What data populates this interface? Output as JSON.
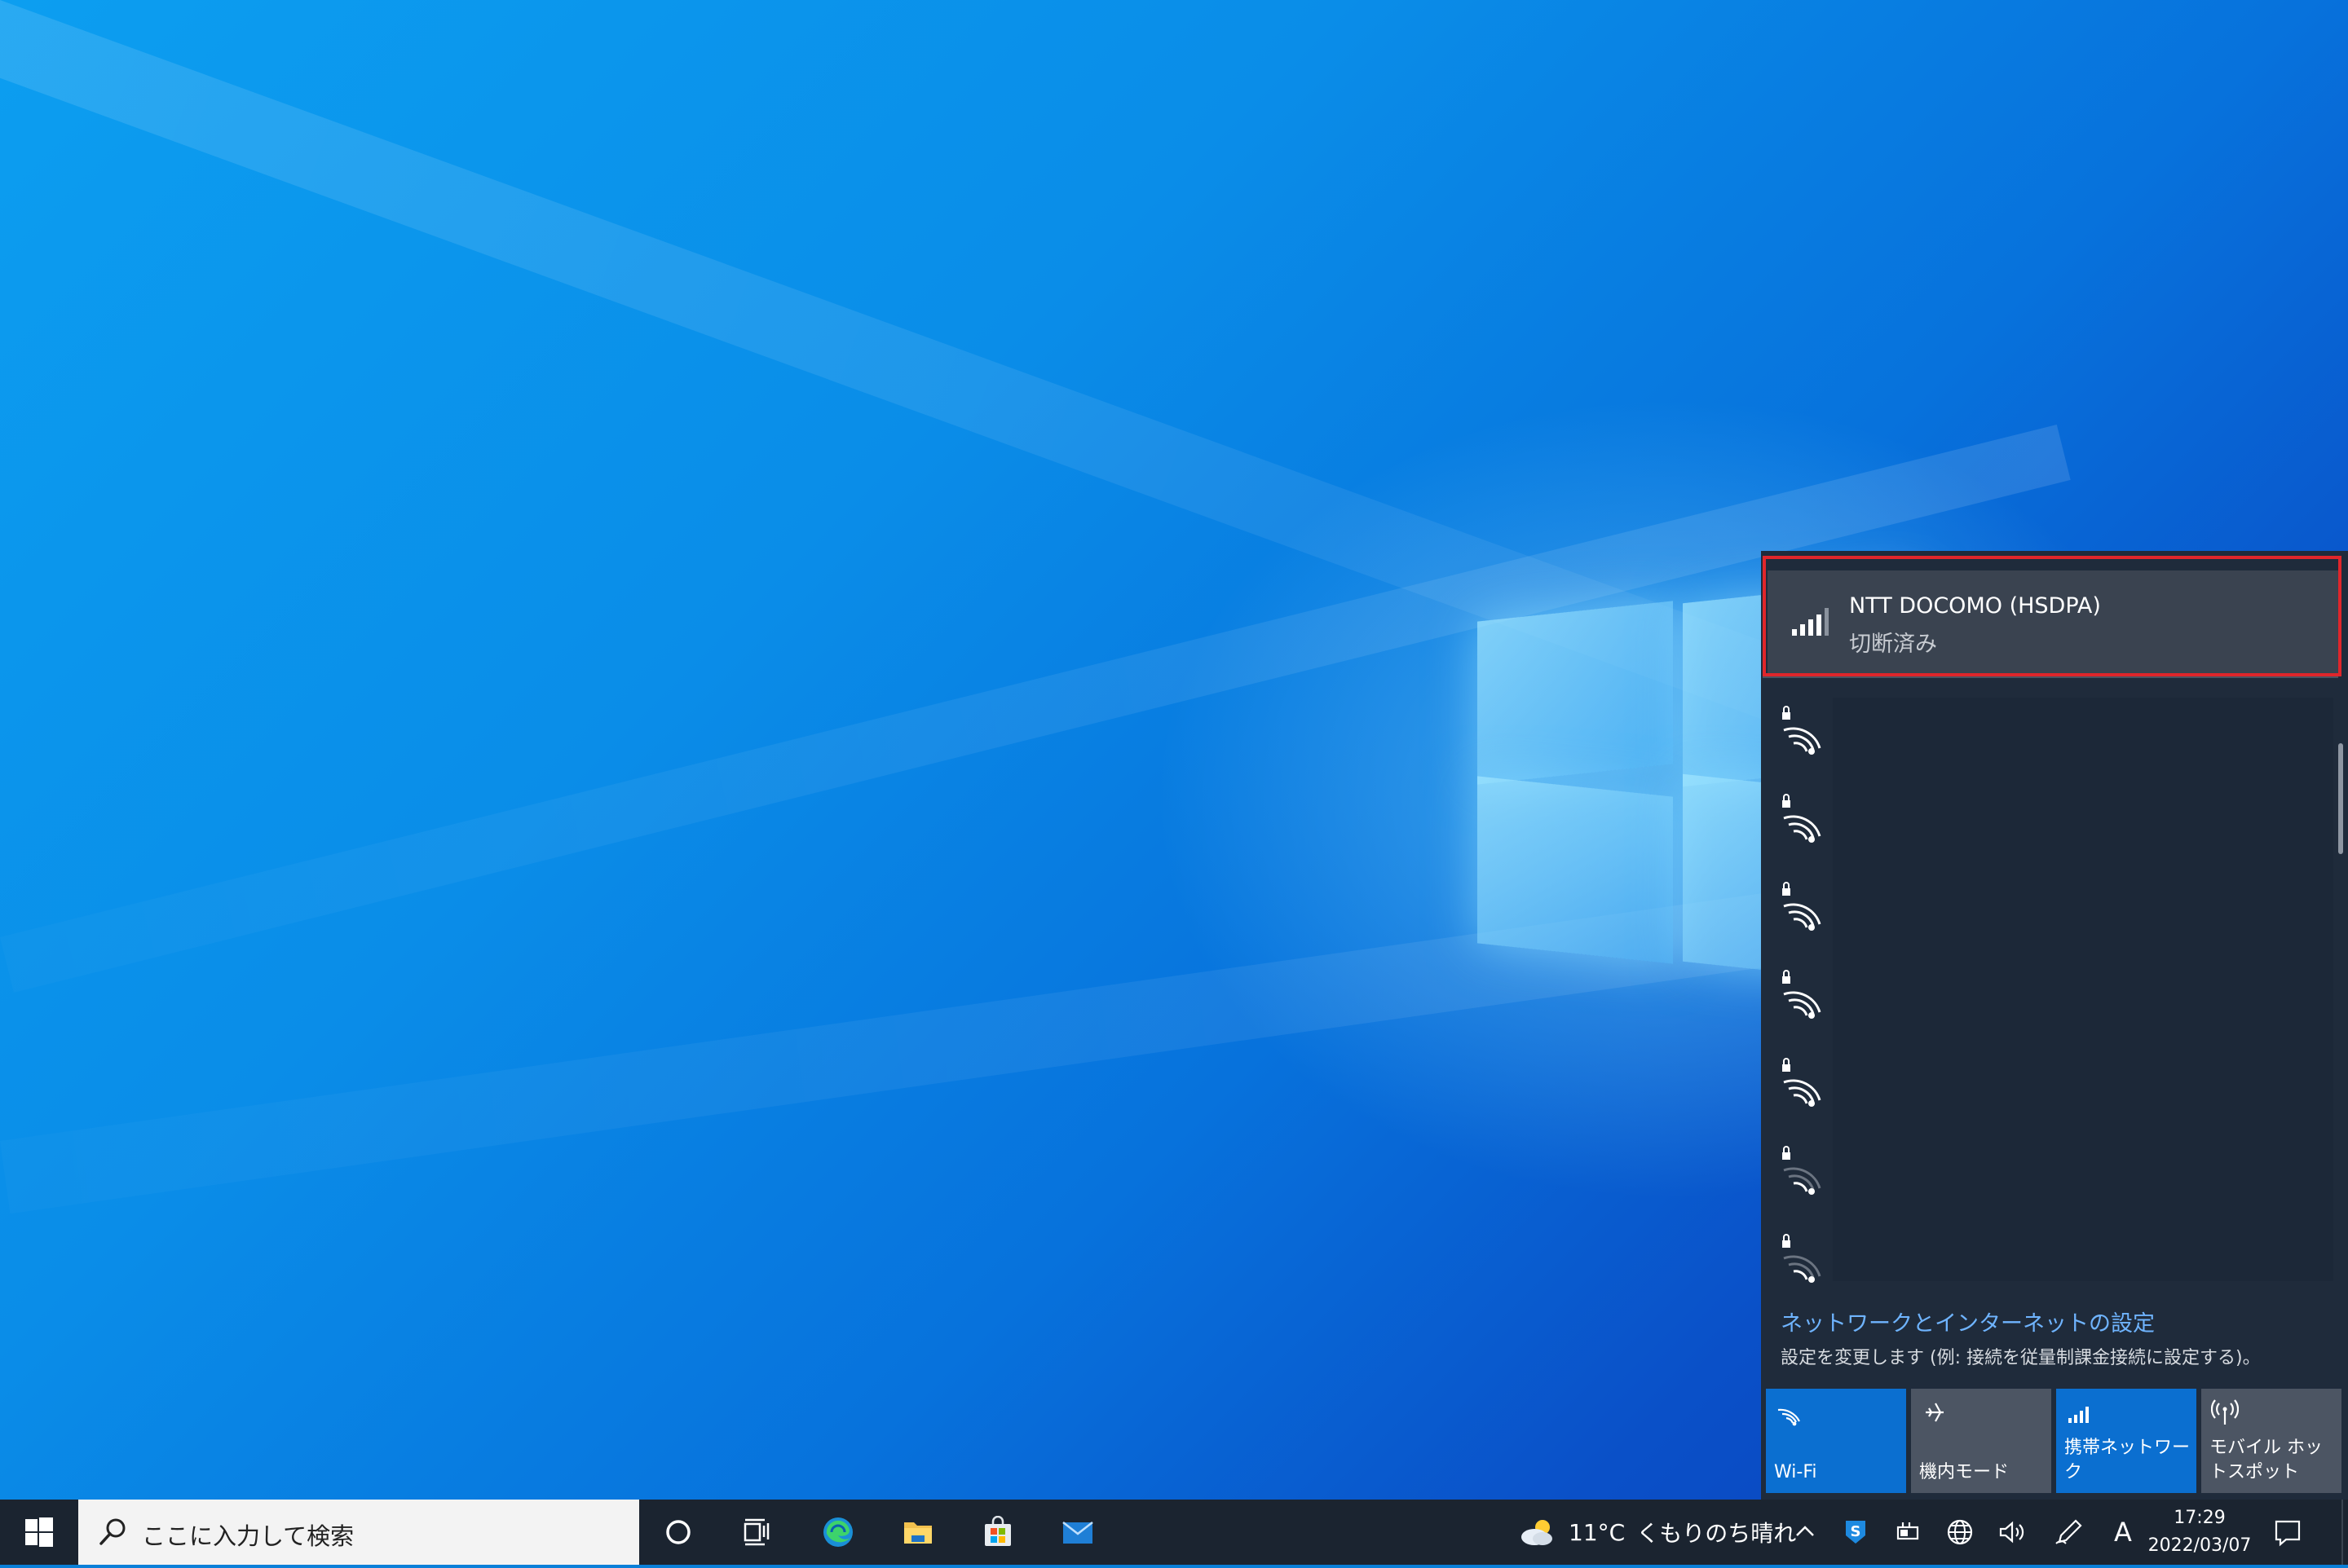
{
  "cellular": {
    "name": "NTT DOCOMO (HSDPA)",
    "status": "切断済み"
  },
  "wifi_networks": [
    {
      "icon": "wifi-secured-icon",
      "strength": "full"
    },
    {
      "icon": "wifi-secured-icon",
      "strength": "full"
    },
    {
      "icon": "wifi-secured-icon",
      "strength": "full"
    },
    {
      "icon": "wifi-secured-icon",
      "strength": "full"
    },
    {
      "icon": "wifi-secured-icon",
      "strength": "full"
    },
    {
      "icon": "wifi-secured-icon",
      "strength": "weak"
    },
    {
      "icon": "wifi-secured-icon",
      "strength": "weak"
    }
  ],
  "settings": {
    "link": "ネットワークとインターネットの設定",
    "description": "設定を変更します (例: 接続を従量制課金接続に設定する)。"
  },
  "quick_actions": [
    {
      "label": "Wi-Fi",
      "icon": "wifi-icon",
      "active": true
    },
    {
      "label": "機内モード",
      "icon": "airplane-icon",
      "active": false
    },
    {
      "label": "携帯ネットワーク",
      "icon": "cellular-icon",
      "active": true
    },
    {
      "label": "モバイル ホットスポット",
      "icon": "hotspot-icon",
      "active": false
    }
  ],
  "taskbar": {
    "search_placeholder": "ここに入力して検索",
    "pinned": [
      "cortana-icon",
      "task-view-icon",
      "edge-icon",
      "file-explorer-icon",
      "store-icon",
      "mail-icon"
    ],
    "weather": {
      "temp": "11°C",
      "condition": "くもりのち晴れ",
      "icon": "partly-cloudy-icon"
    },
    "ime_label": "A",
    "time": "17:29",
    "date": "2022/03/07"
  },
  "colors": {
    "flyout_bg": "#1f2b3b",
    "tile_active": "#0b6fd0",
    "tile_inactive": "#4c5563",
    "highlight": "#e0262b",
    "link": "#6fb4ff"
  }
}
